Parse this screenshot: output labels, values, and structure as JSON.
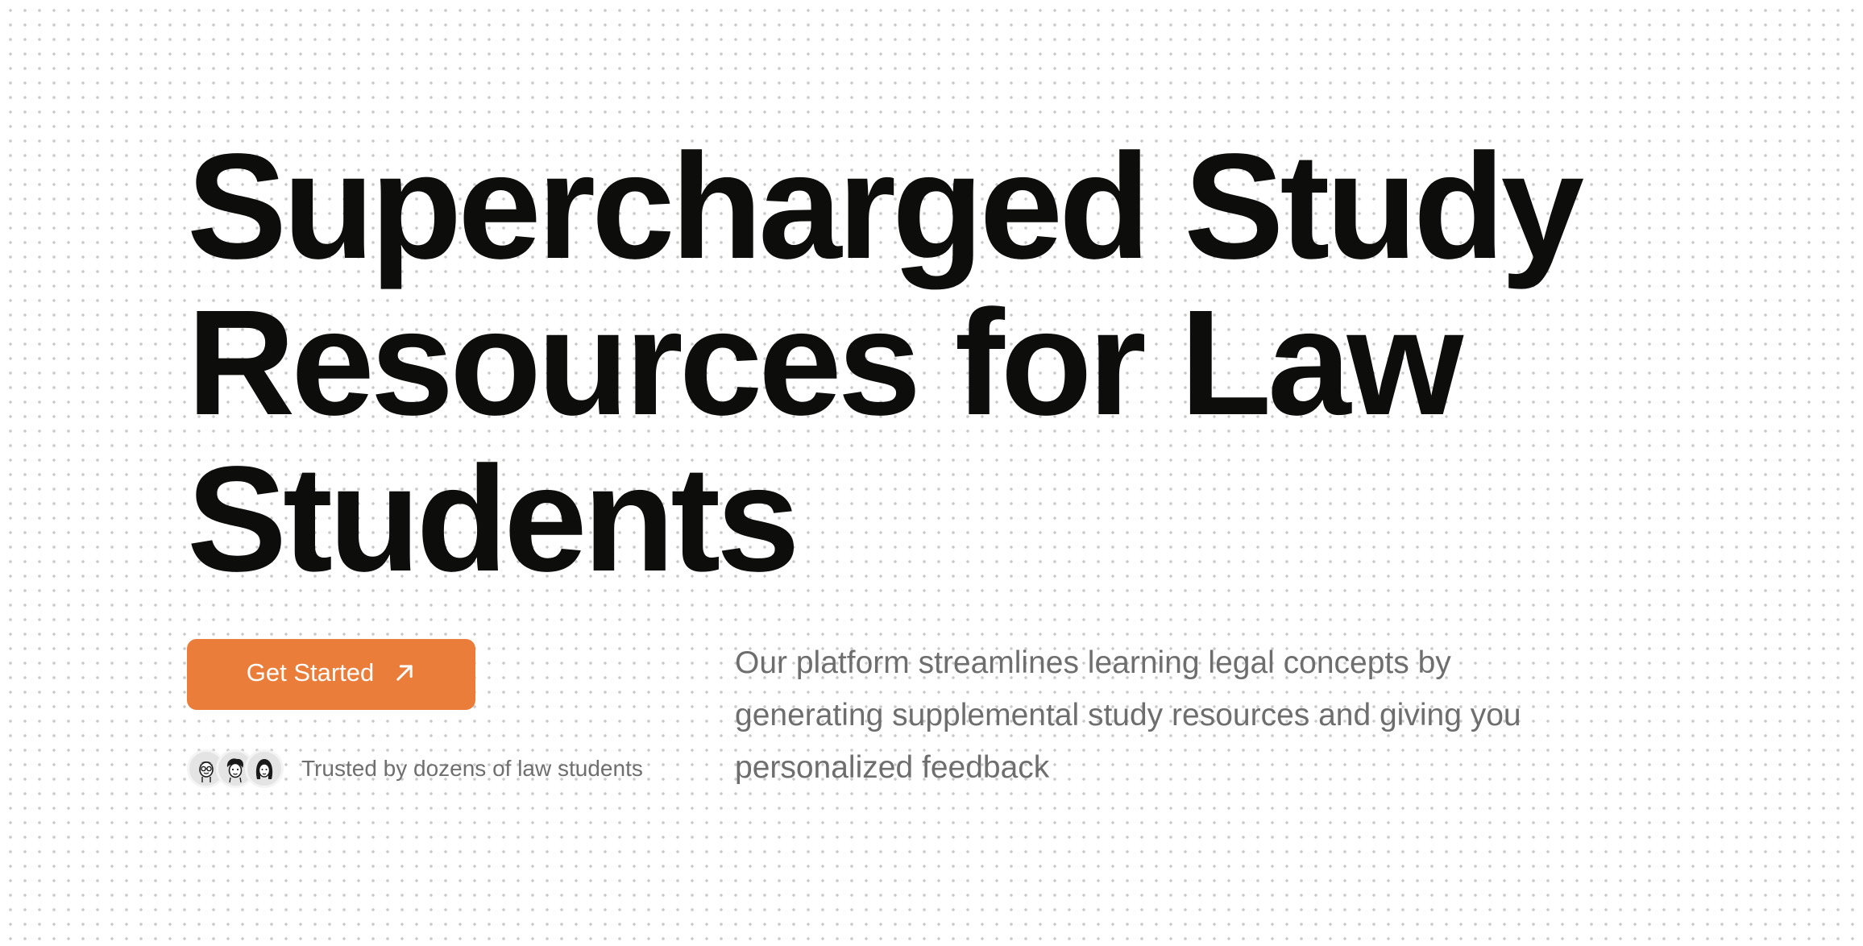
{
  "hero": {
    "headline_lines": [
      "Supercharged Study",
      "Resources for Law",
      "Students"
    ],
    "cta_label": "Get Started",
    "cta_icon": "arrow-up-right-icon",
    "trust_text": "Trusted by dozens of law students",
    "avatar_icons": [
      "avatar-glasses-icon",
      "avatar-curly-hair-icon",
      "avatar-long-hair-icon"
    ],
    "description": "Our platform streamlines learning legal concepts by generating supplemental study resources and giving you personalized feedback"
  },
  "colors": {
    "accent": "#e97d39",
    "headline": "#0d0d0b",
    "muted_text": "#6e6e6e",
    "background": "#ffffff",
    "dot_grid": "#c9c9c9"
  }
}
